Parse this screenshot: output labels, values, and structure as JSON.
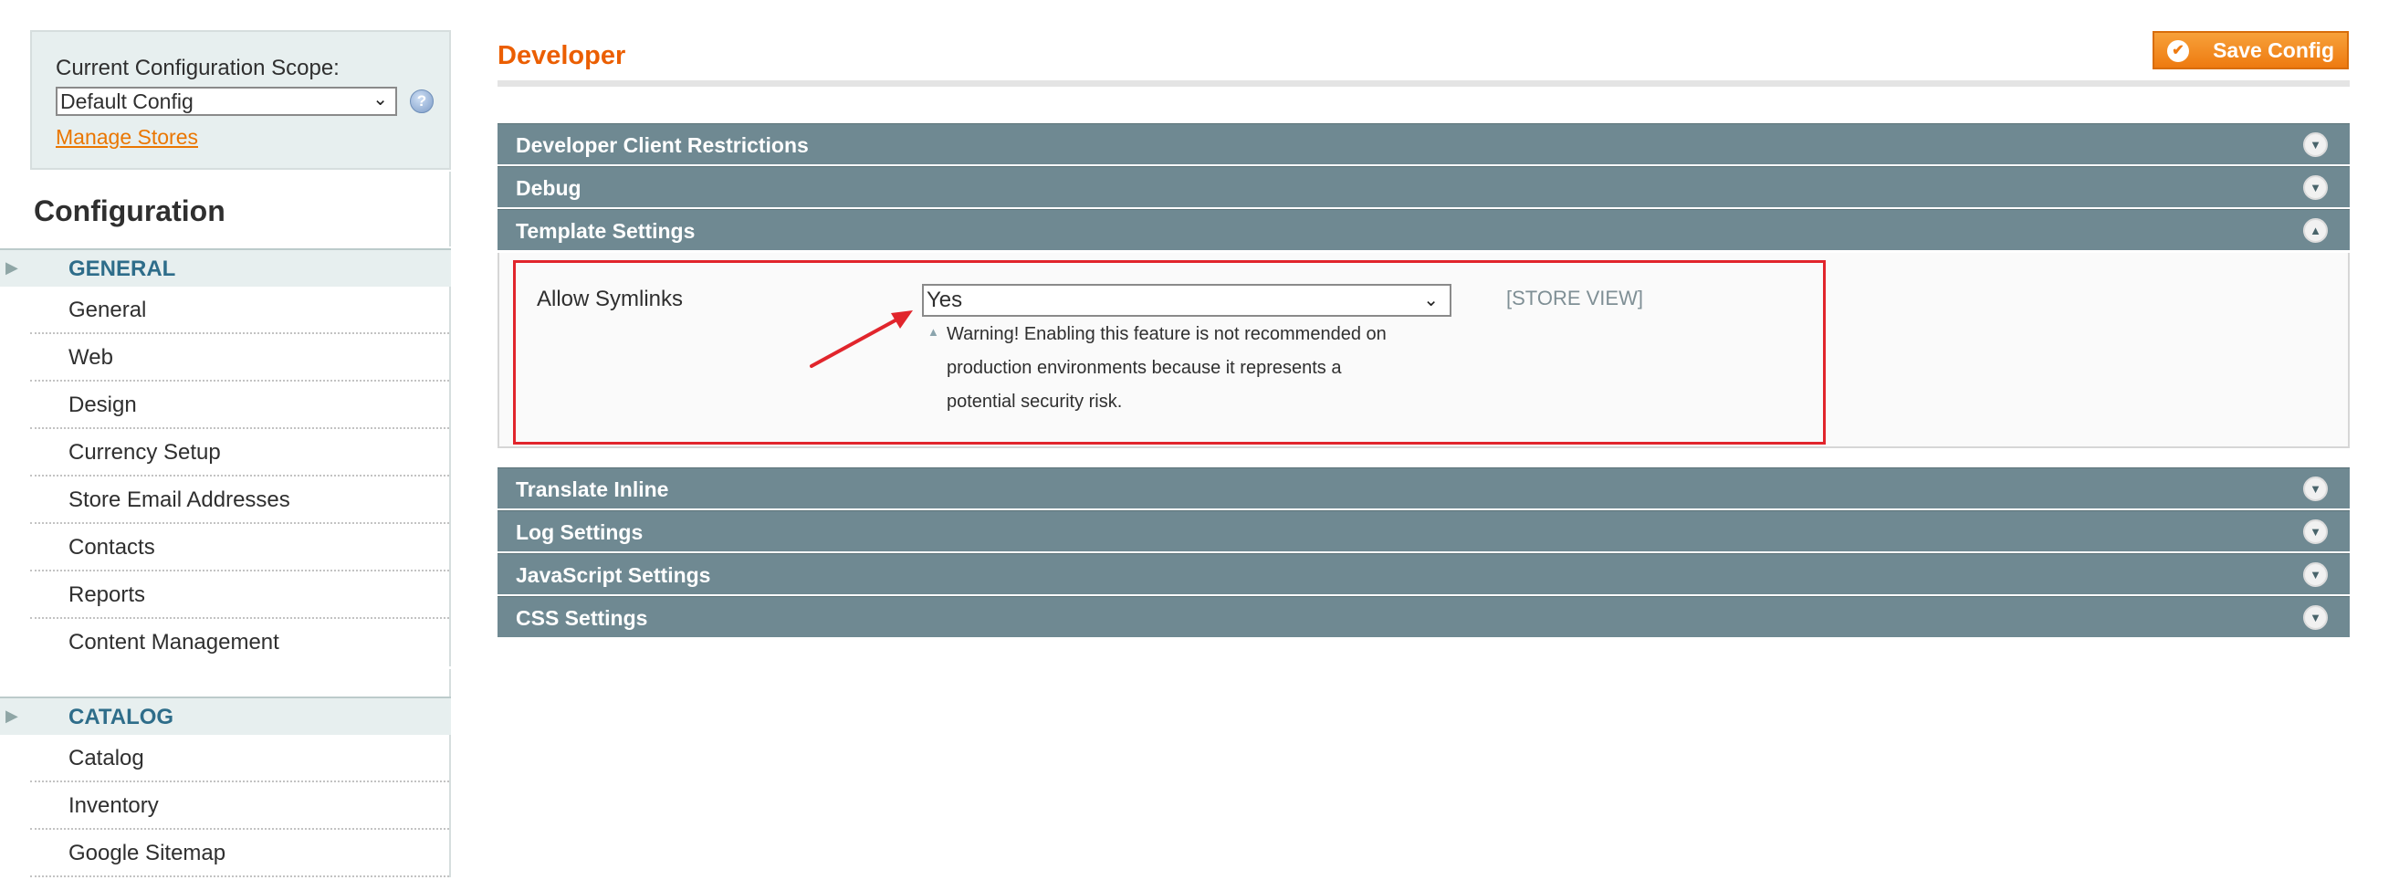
{
  "sidebar": {
    "scope_label": "Current Configuration Scope:",
    "scope_value": "Default Config",
    "manage_stores": "Manage Stores",
    "heading": "Configuration",
    "groups": [
      {
        "label": "GENERAL",
        "items": [
          "General",
          "Web",
          "Design",
          "Currency Setup",
          "Store Email Addresses",
          "Contacts",
          "Reports",
          "Content Management"
        ]
      },
      {
        "label": "CATALOG",
        "items": [
          "Catalog",
          "Inventory",
          "Google Sitemap"
        ]
      }
    ]
  },
  "main": {
    "title": "Developer",
    "save_button": "Save Config",
    "sections_top": [
      {
        "label": "Developer Client Restrictions",
        "state": "collapsed"
      },
      {
        "label": "Debug",
        "state": "collapsed"
      },
      {
        "label": "Template Settings",
        "state": "expanded"
      }
    ],
    "template_settings": {
      "field_label": "Allow Symlinks",
      "field_value": "Yes",
      "scope": "[STORE VIEW]",
      "warning_lines": [
        "Warning! Enabling this feature is not recommended on",
        "production environments because it represents a",
        "potential security risk."
      ]
    },
    "sections_bottom": [
      {
        "label": "Translate Inline",
        "state": "collapsed"
      },
      {
        "label": "Log Settings",
        "state": "collapsed"
      },
      {
        "label": "JavaScript Settings",
        "state": "collapsed"
      },
      {
        "label": "CSS Settings",
        "state": "collapsed"
      }
    ]
  },
  "colors": {
    "accent": "#eb5e00",
    "section_bar": "#6f8992",
    "link": "#ea7601",
    "highlight": "#e1252c",
    "group_label": "#2e6d8a"
  },
  "icons": {
    "help": "help-icon",
    "collapse_toggle": "chevron-down-icon",
    "expand_toggle": "chevron-up-icon",
    "save": "check-icon",
    "warning": "triangle-up-icon",
    "annotation": "red-arrow-icon"
  }
}
